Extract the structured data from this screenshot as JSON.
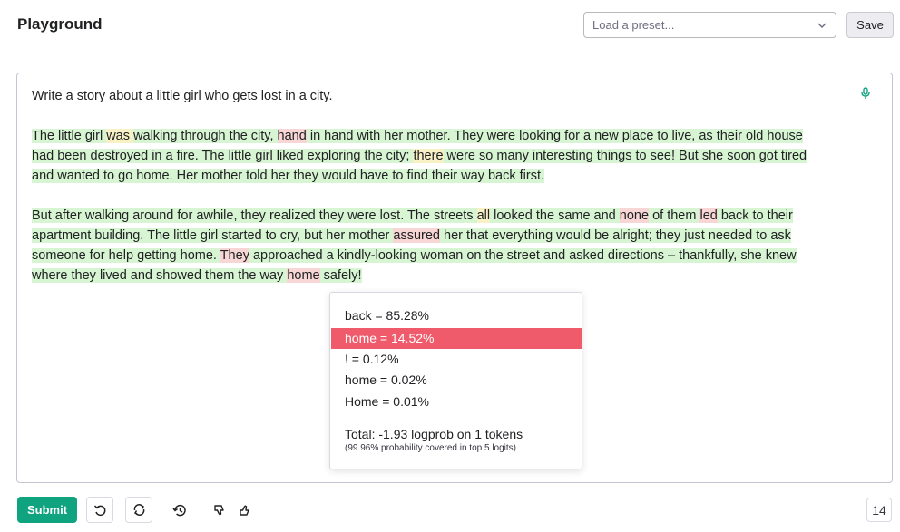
{
  "header": {
    "title": "Playground",
    "preset_placeholder": "Load a preset...",
    "save_label": "Save"
  },
  "editor": {
    "prompt": "Write a story about a little girl who gets lost in a city.",
    "paragraph1": {
      "line1": [
        {
          "t": "The little girl ",
          "c": "g"
        },
        {
          "t": "was ",
          "c": "y"
        },
        {
          "t": "walking through the city, ",
          "c": "g"
        },
        {
          "t": "hand",
          "c": "r"
        },
        {
          "t": " in hand with her mother. They were looking for a new place to live, as their old house",
          "c": "g"
        }
      ],
      "line2": [
        {
          "t": "had been destroyed in a fire. The little girl liked exploring the city; ",
          "c": "g"
        },
        {
          "t": "there",
          "c": "y"
        },
        {
          "t": " were so many interesting things to see! But she soon got tired",
          "c": "g"
        }
      ],
      "line3": [
        {
          "t": " and wanted to go home. Her mother told her they would have to find their way back first.",
          "c": "g"
        }
      ]
    },
    "paragraph2": {
      "line1": [
        {
          "t": "But after walking around for awhile, they realized they were lost. The streets ",
          "c": "g"
        },
        {
          "t": "all",
          "c": "y"
        },
        {
          "t": " looked the same and ",
          "c": "g"
        },
        {
          "t": "none",
          "c": "r"
        },
        {
          "t": " of them ",
          "c": "g"
        },
        {
          "t": "led",
          "c": "r"
        },
        {
          "t": " back to their",
          "c": "g"
        }
      ],
      "line2": [
        {
          "t": "apartment building. The little girl started to cry, but her mother ",
          "c": "g"
        },
        {
          "t": "assured",
          "c": "r"
        },
        {
          "t": " her that everything would be alright; they just needed to ask",
          "c": "g"
        }
      ],
      "line3": [
        {
          "t": "someone for help getting home. ",
          "c": "g"
        },
        {
          "t": "They",
          "c": "r"
        },
        {
          "t": " approached a kindly-looking woman on the street and asked directions – thankfully, she knew",
          "c": "g"
        }
      ],
      "line4": [
        {
          "t": "where they lived and showed them the way ",
          "c": "g"
        },
        {
          "t": "home",
          "c": "r"
        },
        {
          "t": " safely!",
          "c": "g"
        }
      ]
    }
  },
  "popup": {
    "options": [
      {
        "label": "back = 85.28%"
      },
      {
        "label": "home = 14.52%"
      },
      {
        "label": "! = 0.12%"
      },
      {
        "label": "home = 0.02%"
      },
      {
        "label": "Home = 0.01%"
      }
    ],
    "selected_index": 1,
    "total": "Total: -1.93 logprob on 1 tokens",
    "coverage": "(99.96% probability covered in top 5 logits)"
  },
  "footer": {
    "submit_label": "Submit",
    "token_count": "14"
  },
  "icons": {
    "undo": "undo-icon",
    "regenerate": "regenerate-icon",
    "history": "history-icon",
    "thumbs_down": "thumbs-down-icon",
    "thumbs_up": "thumbs-up-icon",
    "mic": "microphone-icon",
    "chevron": "chevron-down-icon"
  },
  "colors": {
    "accent": "#10a37f",
    "selected": "#ef5b6b",
    "high_prob": "#d7f5d2",
    "mid_prob": "#f8f1c6",
    "low_prob": "#f9d6d6"
  }
}
